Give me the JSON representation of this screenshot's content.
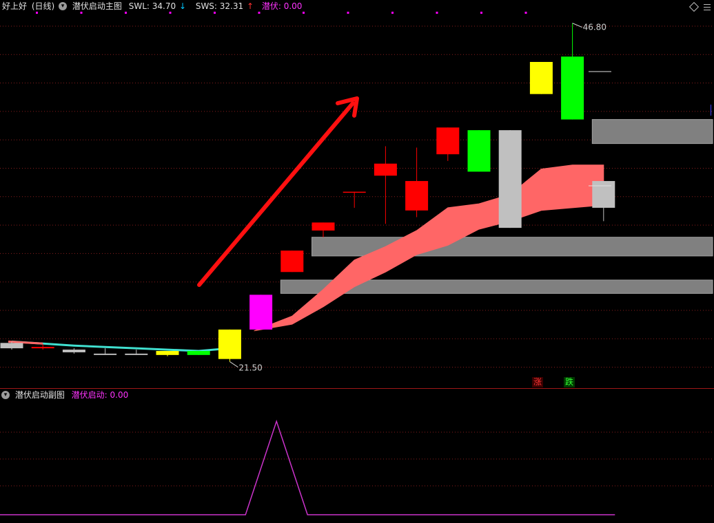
{
  "header": {
    "stock_name": "好上好",
    "period": "(日线)",
    "indicator_name": "潜伏启动主图",
    "swl_label": "SWL: 34.70",
    "swl_arrow": "↓",
    "sws_label": "SWS: 32.31",
    "sws_arrow": "↑",
    "latent_label": "潜伏: 0.00"
  },
  "sub_header": {
    "indicator_name": "潜伏启动副图",
    "value_label": "潜伏启动: 0.00"
  },
  "annotations": {
    "high_label": "46.80",
    "low_label": "21.50",
    "rise_tag": "涨",
    "fall_tag": "跌"
  },
  "colors": {
    "background": "#000000",
    "grid": "#8a1e1e",
    "red_candle": "#ff0000",
    "green_candle": "#00ff00",
    "yellow_candle": "#ffff00",
    "magenta_candle": "#ff00ff",
    "gray_candle": "#c0c0c0",
    "band_fill": "#ff6666",
    "cyan_line": "#40e0d0",
    "zone_gray": "#808080",
    "sub_line": "#cc33cc",
    "purple_text": "#ff33ff"
  },
  "chart_data": {
    "type": "candlestick",
    "x": [
      1,
      2,
      3,
      4,
      5,
      6,
      7,
      8,
      9,
      10,
      11,
      12,
      13,
      14,
      15,
      16,
      17,
      18,
      19,
      20
    ],
    "candles": [
      {
        "open": 22.9,
        "close": 22.5,
        "high": 23.0,
        "low": 22.4,
        "color": "gray"
      },
      {
        "open": 22.6,
        "close": 22.5,
        "high": 22.8,
        "low": 22.4,
        "color": "red"
      },
      {
        "open": 22.4,
        "close": 22.2,
        "high": 22.5,
        "low": 22.1,
        "color": "gray"
      },
      {
        "open": 22.1,
        "close": 22.0,
        "high": 22.5,
        "low": 22.0,
        "color": "gray"
      },
      {
        "open": 22.1,
        "close": 22.0,
        "high": 22.4,
        "low": 22.0,
        "color": "gray"
      },
      {
        "open": 22.0,
        "close": 22.3,
        "high": 22.3,
        "low": 21.9,
        "color": "yellow"
      },
      {
        "open": 22.0,
        "close": 22.3,
        "high": 22.3,
        "low": 22.0,
        "color": "green"
      },
      {
        "open": 21.7,
        "close": 23.9,
        "high": 23.9,
        "low": 21.5,
        "color": "yellow"
      },
      {
        "open": 23.9,
        "close": 26.5,
        "high": 26.5,
        "low": 23.9,
        "color": "magenta"
      },
      {
        "open": 28.2,
        "close": 29.8,
        "high": 29.8,
        "low": 28.2,
        "color": "red"
      },
      {
        "open": 31.3,
        "close": 31.9,
        "high": 31.9,
        "low": 30.8,
        "color": "red"
      },
      {
        "open": 34.2,
        "close": 34.2,
        "high": 34.2,
        "low": 33.0,
        "color": "red"
      },
      {
        "open": 35.4,
        "close": 36.3,
        "high": 37.6,
        "low": 31.8,
        "color": "red"
      },
      {
        "open": 32.8,
        "close": 35.0,
        "high": 37.5,
        "low": 32.3,
        "color": "red"
      },
      {
        "open": 37.0,
        "close": 39.0,
        "high": 39.0,
        "low": 36.5,
        "color": "red"
      },
      {
        "open": 38.8,
        "close": 35.7,
        "high": 38.8,
        "low": 35.7,
        "color": "green"
      },
      {
        "open": 38.8,
        "close": 31.5,
        "high": 38.8,
        "low": 31.5,
        "color": "gray"
      },
      {
        "open": 41.5,
        "close": 43.9,
        "high": 43.9,
        "low": 41.5,
        "color": "yellow"
      },
      {
        "open": 44.3,
        "close": 39.6,
        "high": 46.8,
        "low": 39.6,
        "color": "green"
      },
      {
        "open": 35.0,
        "close": 33.0,
        "high": 35.0,
        "low": 32.0,
        "color": "gray"
      }
    ],
    "band_upper": [
      null,
      null,
      null,
      null,
      null,
      null,
      null,
      null,
      23.8,
      24.9,
      26.9,
      29.1,
      30.1,
      31.3,
      33.0,
      33.3,
      34.0,
      35.9,
      36.2,
      36.2
    ],
    "band_lower": [
      null,
      null,
      null,
      null,
      null,
      null,
      null,
      null,
      23.8,
      24.3,
      25.6,
      27.1,
      28.2,
      29.5,
      30.2,
      31.4,
      32.0,
      32.8,
      33.0,
      33.2
    ],
    "ma_short": [
      23.0,
      22.85,
      22.7,
      22.6,
      22.5,
      22.4,
      22.3,
      22.5
    ],
    "support_zones": [
      {
        "top": 30.8,
        "bottom": 29.4,
        "from": 11
      },
      {
        "top": 27.6,
        "bottom": 26.6,
        "from": 10
      },
      {
        "top": 39.6,
        "bottom": 37.8,
        "from": 20
      }
    ],
    "ylim": [
      20.5,
      47.5
    ],
    "sub_series": [
      0,
      0,
      0,
      0,
      0,
      0,
      0,
      0,
      0,
      0,
      0,
      0,
      0,
      0,
      0,
      0,
      0,
      0,
      0,
      0
    ],
    "sub_peak": {
      "x": 9.5,
      "value": 1.0
    },
    "sub_ylim": [
      0,
      1.2
    ]
  }
}
